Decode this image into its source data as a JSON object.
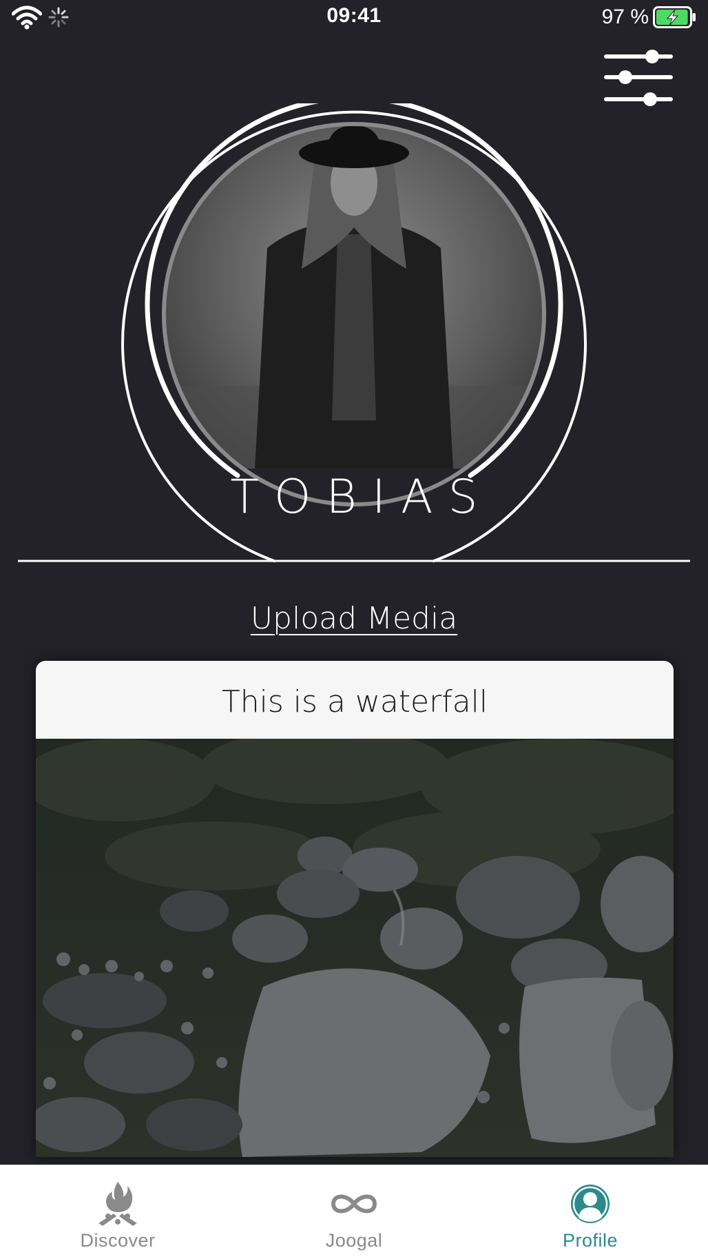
{
  "status_bar": {
    "time": "09:41",
    "battery_percent": "97 %",
    "battery_level": 0.97,
    "charging": true,
    "icons": [
      "wifi-icon",
      "activity-spinner-icon",
      "battery-charging-icon"
    ]
  },
  "header": {
    "filter_icon": "sliders-icon"
  },
  "profile": {
    "name": "TOBIAS",
    "avatar_icon": "profile-photo"
  },
  "upload": {
    "label": "Upload Media"
  },
  "media_card": {
    "title": "This is a waterfall",
    "image": "waterfall-rocks-photo"
  },
  "tab_bar": {
    "tabs": [
      {
        "label": "Discover",
        "icon": "campfire-icon",
        "active": false
      },
      {
        "label": "Joogal",
        "icon": "infinity-icon",
        "active": false
      },
      {
        "label": "Profile",
        "icon": "person-circle-icon",
        "active": true
      }
    ]
  },
  "colors": {
    "background": "#232228",
    "accent": "#2a8a8c",
    "tab_inactive": "#8a8a8a",
    "card_background": "#f6f6f6",
    "battery_fill": "#4cd964"
  }
}
